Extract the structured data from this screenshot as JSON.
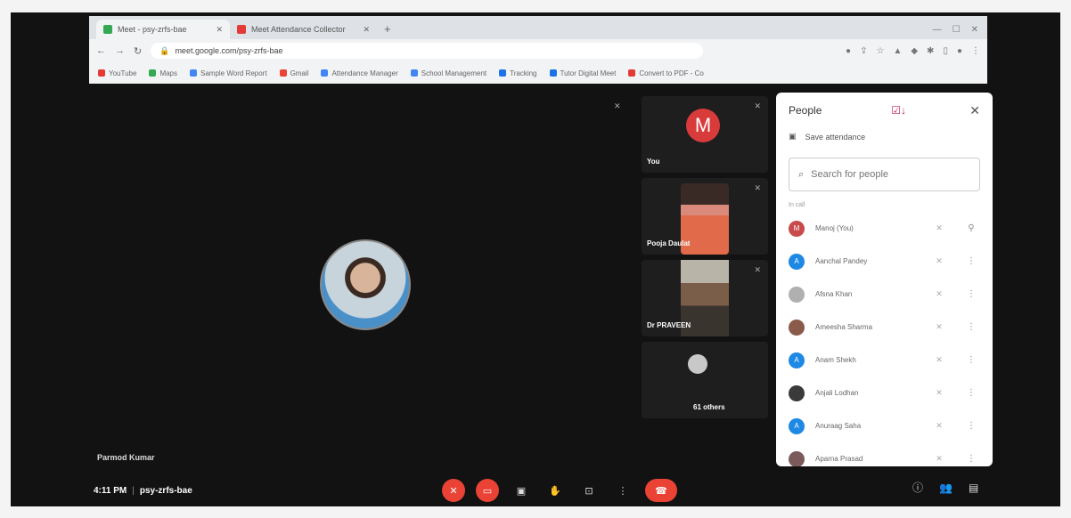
{
  "browser": {
    "tabs": [
      {
        "label": "Meet - psy-zrfs-bae",
        "active": true
      },
      {
        "label": "Meet Attendance Collector",
        "active": false
      }
    ],
    "url": "meet.google.com/psy-zrfs-bae",
    "bookmarks": [
      "YouTube",
      "Maps",
      "Sample Word Report",
      "Gmail",
      "Attendance Manager",
      "School Management",
      "Tracking",
      "Tutor Digital Meet",
      "Convert to PDF - Co"
    ]
  },
  "meeting": {
    "main_speaker": "Parmod Kumar",
    "time": "4:11 PM",
    "code": "psy-zrfs-bae"
  },
  "thumbnails": [
    {
      "label": "You",
      "initial": "M"
    },
    {
      "label": "Pooja Daulat"
    },
    {
      "label": "Dr PRAVEEN"
    },
    {
      "label": "61 others"
    }
  ],
  "people_panel": {
    "title": "People",
    "save_attendance": "Save attendance",
    "search_placeholder": "Search for people",
    "section_label": "In call",
    "participants": [
      {
        "name": "Manoj (You)",
        "initial": "M",
        "color": "#c94a4a"
      },
      {
        "name": "Aanchal Pandey",
        "initial": "A",
        "color": "#1e88e5"
      },
      {
        "name": "Afsna Khan",
        "initial": "",
        "color": "#b0b0b0"
      },
      {
        "name": "Ameesha Sharma",
        "initial": "",
        "color": "#8a5a4a"
      },
      {
        "name": "Anam Shekh",
        "initial": "A",
        "color": "#1e88e5"
      },
      {
        "name": "Anjali Lodhan",
        "initial": "",
        "color": "#3a3a3a"
      },
      {
        "name": "Anuraag Saha",
        "initial": "A",
        "color": "#1e88e5"
      },
      {
        "name": "Aparna Prasad",
        "initial": "",
        "color": "#7a5a5a"
      }
    ]
  },
  "colors": {
    "accent_red": "#ea4335",
    "avatar_blue": "#1e88e5"
  },
  "icons": [
    "mic-off-icon",
    "camera-off-icon",
    "captions-icon",
    "raise-hand-icon",
    "present-icon",
    "more-options-icon",
    "end-call-icon",
    "info-icon",
    "people-icon",
    "chat-icon",
    "close-icon",
    "search-icon",
    "pin-icon",
    "attendance-icon"
  ]
}
